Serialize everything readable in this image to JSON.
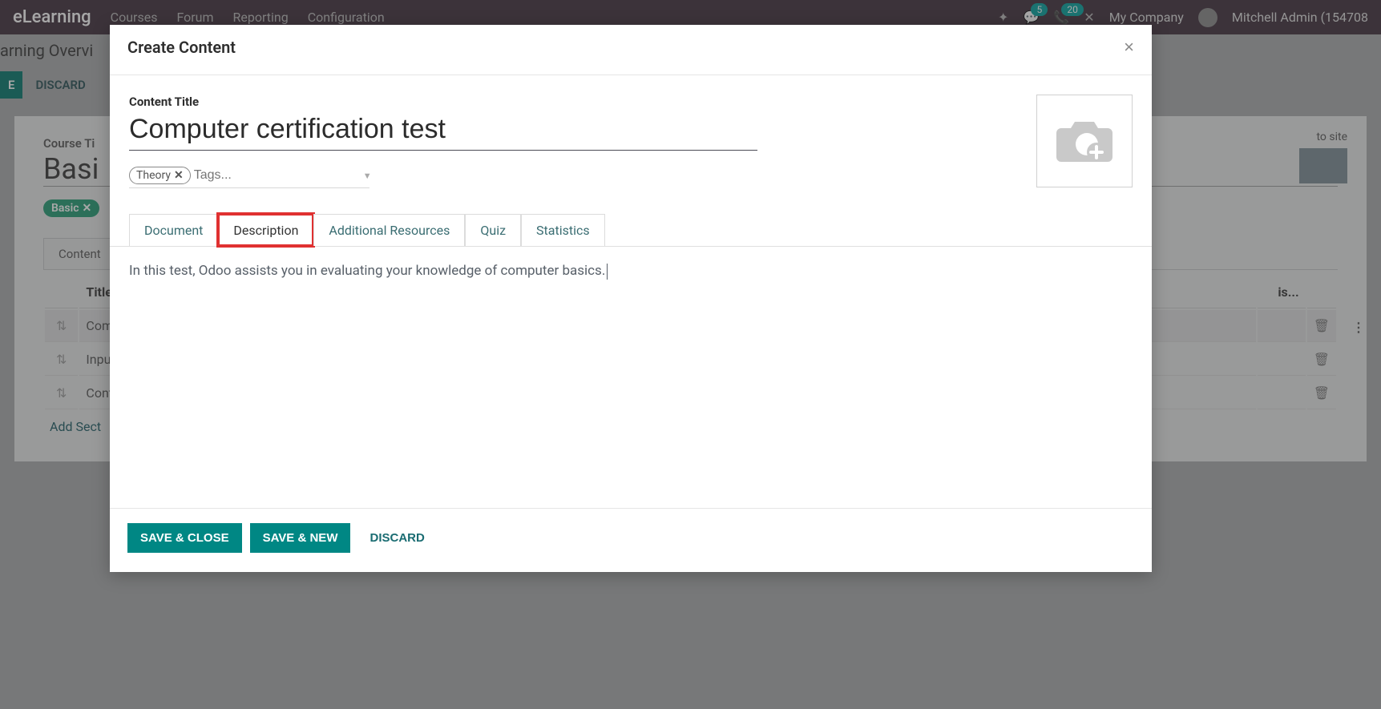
{
  "header": {
    "app_title": "eLearning",
    "nav": [
      "Courses",
      "Forum",
      "Reporting",
      "Configuration"
    ],
    "badge_chat": "5",
    "badge_phone": "20",
    "company": "My Company",
    "user_name": "Mitchell Admin (154708"
  },
  "bg": {
    "breadcrumb": "arning Overvi",
    "save": "E",
    "discard": "DISCARD",
    "course_label": "Course Ti",
    "course_title": "Basi",
    "basic_tag": "Basic",
    "content_tab": "Content",
    "title_header": "Title",
    "vis_header": "is...",
    "rows": [
      "Compute",
      "Input",
      "Control U"
    ],
    "add_section": "Add Sect",
    "goto": "to\nsite"
  },
  "modal": {
    "title": "Create Content",
    "field_label": "Content Title",
    "title_value": "Computer certification test",
    "tag": "Theory",
    "tags_placeholder": "Tags...",
    "tabs": [
      "Document",
      "Description",
      "Additional Resources",
      "Quiz",
      "Statistics"
    ],
    "active_tab_index": 1,
    "description_text": "In this test, Odoo assists you in evaluating your knowledge of computer basics.",
    "save_close": "SAVE & CLOSE",
    "save_new": "SAVE & NEW",
    "discard": "DISCARD"
  }
}
